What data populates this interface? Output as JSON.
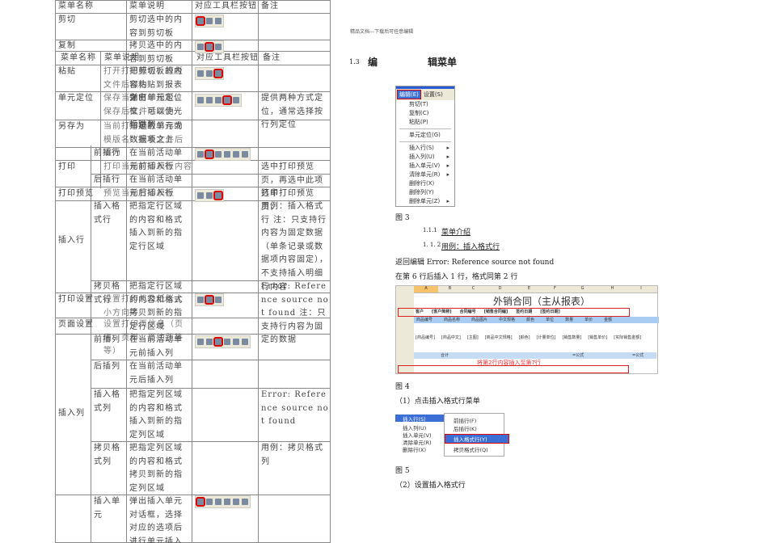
{
  "left_table": {
    "cells": [
      "菜单名称",
      "菜单说明",
      "对应工具栏按钮",
      "备注",
      "剪切",
      "剪切选中的内容到剪切板",
      "复制",
      "拷贝选中的内容到剪切板",
      "菜单名称",
      "菜单说明",
      "对应工具栏按钮",
      "备注",
      "粘贴",
      "打开打印模板，模板文件后缀为",
      "把剪切板的内容粘贴到报表之中",
      "单元定位",
      "保存当前打印模板，保存后文件后缀为",
      "弹出单元定位框，可以使光标跳到",
      "提供两种方式定位，通常选择按行列定位",
      "另存为",
      "当前打印模板另存为模版名（模板文件后缀为",
      "指定的单元或数据项之上",
      "前插行",
      "在当前活动单元前插入行",
      "打印",
      "打印当前打印模板内容",
      "选中打印预览页，再选中此项打印",
      "后插行",
      "在当前活动单元后插入行",
      "打印预览",
      "预览当前打印模板",
      "选中打印预览页，",
      "插入行",
      "插入格式行",
      "把指定行区域的内容和格式插入到新的指定行区域",
      "用例：插入格式行 注：只支持行内容为固定数据（单条记录或数据项内容固定），不支持插入明细行内容",
      "拷贝格式行",
      "把指定行区域的内容和格式拷贝到新的指定行区域",
      "Error: Reference source not found 注：只支持行内容为固定的数据",
      "打印设置",
      "设置打印机及纸张大小方向等",
      "页面设置",
      "设置打印页信息（页眉、页脚、页边距等等）",
      "前插列",
      "在当前活动单元前插入列",
      "后插列",
      "在当前活动单元后插入列",
      "插入列",
      "插入格式列",
      "把指定列区域的内容和格式插入到新的指定列区域",
      "Error: Reference source not found",
      "拷贝格式列",
      "把指定列区域的内容和格式拷贝到新的指定列区域",
      "用例：拷贝格式列",
      "插入单元",
      "弹出插入单元对话框，选择对应的选项后进行单元插入操作"
    ]
  },
  "right": {
    "header": "精品文档---下载后可任意编辑",
    "section_num": "1.3",
    "section_a": "编",
    "section_b": "辑菜单",
    "menu": {
      "top": [
        "编辑(E)",
        "设置(S)"
      ],
      "items": [
        "剪切(T)",
        "复制(C)",
        "粘贴(P)",
        "单元定位(G)",
        "插入行(S)",
        "插入列(U)",
        "插入单元(V)",
        "清除单元(R)",
        "删除行(X)",
        "删除列(Y)",
        "删除单元(Z)"
      ]
    },
    "fig3": "图 3",
    "h111_num": "1.1.1",
    "h111": "菜单介绍",
    "h112_num": "1. 1. 2",
    "h112": "用例：插入格式行",
    "p1": "返回编辑 Error: Reference source not found",
    "p2": "在第 6 行后插入 1 行，格式同第 2 行",
    "sheet": {
      "cols": [
        "A",
        "B",
        "C",
        "D",
        "E",
        "F",
        "G",
        "H",
        "I"
      ],
      "title": "外销合同（主从报表）",
      "row2": [
        "客户",
        "[客户简称]",
        "",
        "合同编号",
        "[销售合同编]",
        "",
        "签约日期",
        "[签约日期]"
      ],
      "row3": [
        "商品编号",
        "商品名称",
        "商品图片",
        "中文规格",
        "颜色",
        "单位",
        "数量",
        "单价",
        "金额"
      ],
      "row4": [
        "[商品编号]",
        "[商品中文]",
        "[主图]",
        "[商品中文规格]",
        "[颜色]",
        "[计量单位]",
        "[销售数量]",
        "[销售单价]",
        "[实际销售金额]"
      ],
      "row5": [
        "",
        "合计",
        "",
        "",
        "",
        "",
        "=公式",
        "",
        "=公式"
      ],
      "note": "将第2行内容插入至第7行"
    },
    "fig4": "图 4",
    "step1": "（1）点击插入格式行菜单",
    "submenu": {
      "left": [
        "插入行(S)",
        "插入列(U)",
        "插入单元(V)",
        "清除单元(R)",
        "删除行(X)"
      ],
      "right": [
        "前插行(F)",
        "后插行(K)",
        "插入格式行(Y)",
        "拷贝格式行(Q)"
      ]
    },
    "fig5": "图 5",
    "step2": "（2）设置插入格式行"
  }
}
